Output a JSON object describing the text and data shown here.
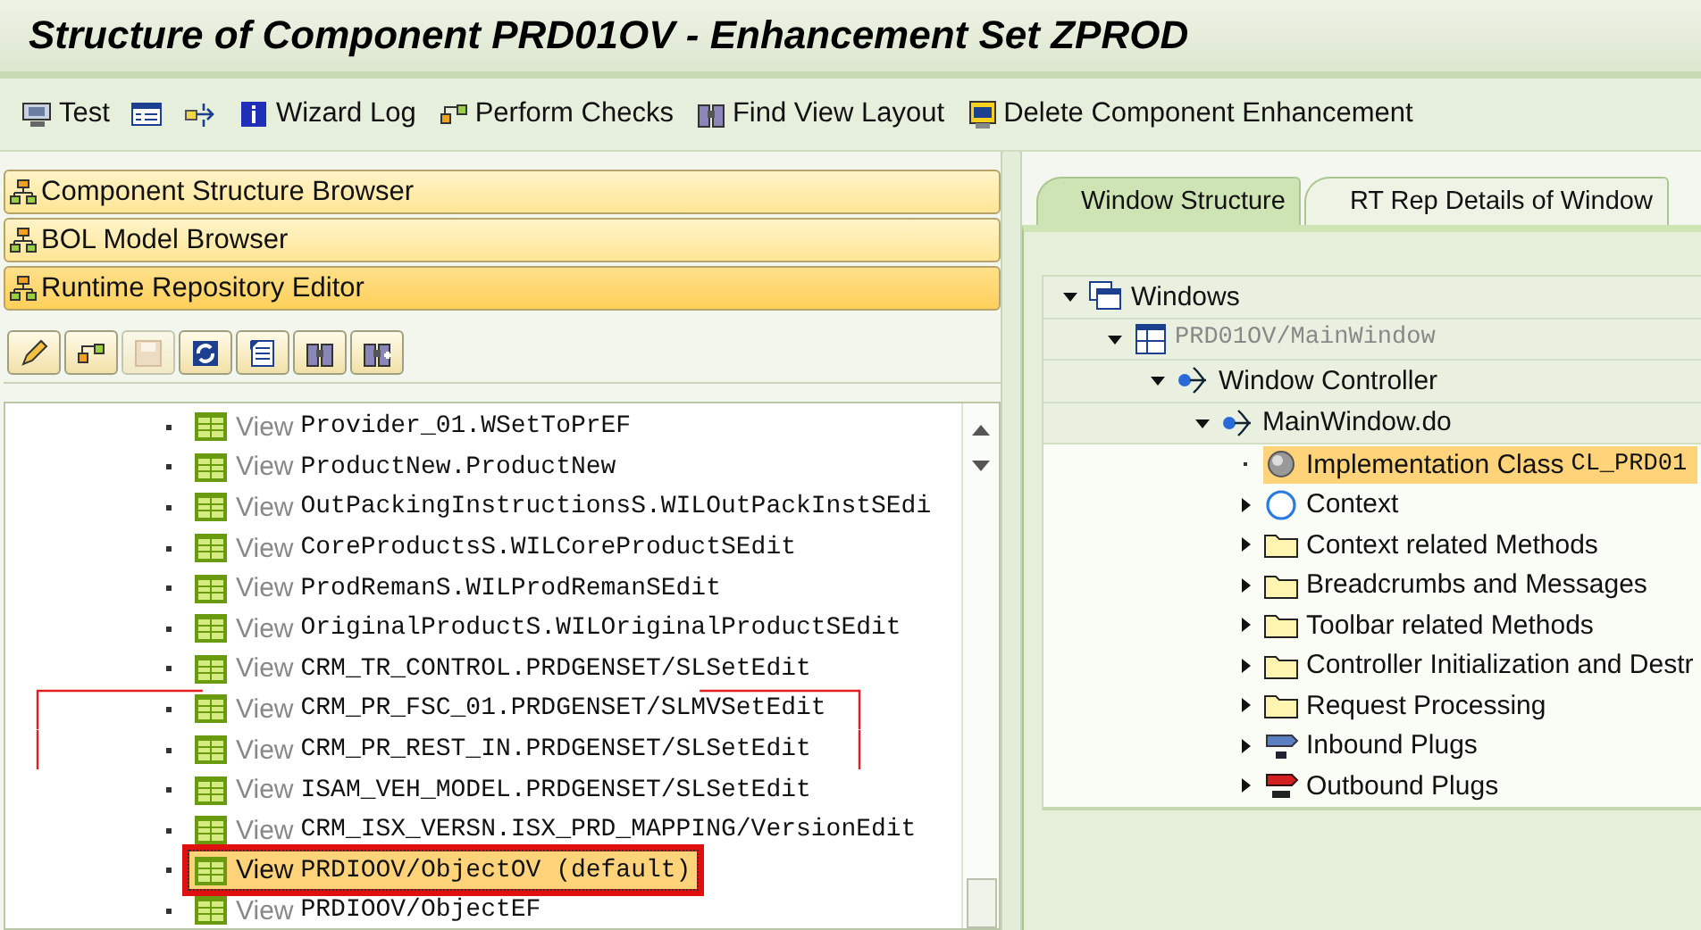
{
  "title": "Structure of Component PRD01OV - Enhancement Set ZPROD",
  "toolbar": [
    {
      "kind": "test",
      "label": "Test"
    },
    {
      "kind": "list"
    },
    {
      "kind": "navigate"
    },
    {
      "kind": "info",
      "label": "Wizard Log"
    },
    {
      "kind": "checks",
      "label": "Perform Checks"
    },
    {
      "kind": "find",
      "label": "Find View Layout"
    },
    {
      "kind": "delete",
      "label": "Delete Component Enhancement"
    }
  ],
  "panels": [
    {
      "label": "Component Structure Browser",
      "selected": false
    },
    {
      "label": "BOL Model Browser",
      "selected": false
    },
    {
      "label": "Runtime Repository Editor",
      "selected": true
    }
  ],
  "editor_tools": [
    {
      "kind": "edit",
      "disabled": false
    },
    {
      "kind": "checks",
      "disabled": false
    },
    {
      "kind": "save",
      "disabled": true
    },
    {
      "kind": "refresh",
      "disabled": false
    },
    {
      "kind": "list",
      "disabled": false
    },
    {
      "kind": "find",
      "disabled": false
    },
    {
      "kind": "find-more",
      "disabled": false
    }
  ],
  "views": [
    {
      "prefix": "View",
      "name": "Provider_01.WSetToPrEF",
      "selected": false,
      "bracketed": false,
      "boxed": false
    },
    {
      "prefix": "View",
      "name": "ProductNew.ProductNew",
      "selected": false,
      "bracketed": false,
      "boxed": false
    },
    {
      "prefix": "View",
      "name": "OutPackingInstructionsS.WILOutPackInstSEdi",
      "selected": false,
      "bracketed": false,
      "boxed": false
    },
    {
      "prefix": "View",
      "name": "CoreProductsS.WILCoreProductSEdit",
      "selected": false,
      "bracketed": false,
      "boxed": false
    },
    {
      "prefix": "View",
      "name": "ProdRemanS.WILProdRemanSEdit",
      "selected": false,
      "bracketed": false,
      "boxed": false
    },
    {
      "prefix": "View",
      "name": "OriginalProductS.WILOriginalProductSEdit",
      "selected": false,
      "bracketed": false,
      "boxed": false
    },
    {
      "prefix": "View",
      "name": "CRM_TR_CONTROL.PRDGENSET/SLSetEdit",
      "selected": false,
      "bracketed": false,
      "boxed": false
    },
    {
      "prefix": "View",
      "name": "CRM_PR_FSC_01.PRDGENSET/SLMVSetEdit",
      "selected": false,
      "bracketed": true,
      "boxed": false
    },
    {
      "prefix": "View",
      "name": "CRM_PR_REST_IN.PRDGENSET/SLSetEdit",
      "selected": false,
      "bracketed": true,
      "boxed": false
    },
    {
      "prefix": "View",
      "name": "ISAM_VEH_MODEL.PRDGENSET/SLSetEdit",
      "selected": false,
      "bracketed": false,
      "boxed": false
    },
    {
      "prefix": "View",
      "name": "CRM_ISX_VERSN.ISX_PRD_MAPPING/VersionEdit",
      "selected": false,
      "bracketed": false,
      "boxed": false
    },
    {
      "prefix": "View",
      "name": "PRDIOOV/ObjectOV (default)",
      "selected": true,
      "bracketed": false,
      "boxed": true
    },
    {
      "prefix": "View",
      "name": "PRDIOOV/ObjectEF",
      "selected": false,
      "bracketed": false,
      "boxed": false
    }
  ],
  "tabs": [
    {
      "label": "Window Structure",
      "selected": true
    },
    {
      "label": "RT Rep Details of Window",
      "selected": false
    }
  ],
  "tree": [
    {
      "label": "Windows",
      "kind": "windows",
      "expanded": true,
      "selected": false,
      "children": [
        {
          "label": "PRD01OV/MainWindow",
          "kind": "window",
          "expanded": true,
          "selected": false,
          "children": [
            {
              "label": "Window Controller",
              "kind": "controller",
              "expanded": true,
              "selected": false,
              "children": [
                {
                  "label": "MainWindow.do",
                  "kind": "controller",
                  "expanded": true,
                  "selected": false,
                  "children": [
                    {
                      "label": "Implementation Class",
                      "value": "CL_PRD01",
                      "kind": "class",
                      "expanded": false,
                      "selected": true
                    },
                    {
                      "label": "Context",
                      "kind": "context",
                      "expanded": false,
                      "selected": false
                    },
                    {
                      "label": "Context related Methods",
                      "kind": "folder",
                      "expanded": false,
                      "selected": false
                    },
                    {
                      "label": "Breadcrumbs and Messages",
                      "kind": "folder",
                      "expanded": false,
                      "selected": false
                    },
                    {
                      "label": "Toolbar related Methods",
                      "kind": "folder",
                      "expanded": false,
                      "selected": false
                    },
                    {
                      "label": "Controller Initialization and Destr",
                      "kind": "folder",
                      "expanded": false,
                      "selected": false
                    },
                    {
                      "label": "Request Processing",
                      "kind": "folder",
                      "expanded": false,
                      "selected": false
                    },
                    {
                      "label": "Inbound Plugs",
                      "kind": "inbound",
                      "expanded": false,
                      "selected": false
                    },
                    {
                      "label": "Outbound Plugs",
                      "kind": "outbound",
                      "expanded": false,
                      "selected": false
                    }
                  ]
                }
              ]
            }
          ]
        }
      ]
    }
  ]
}
